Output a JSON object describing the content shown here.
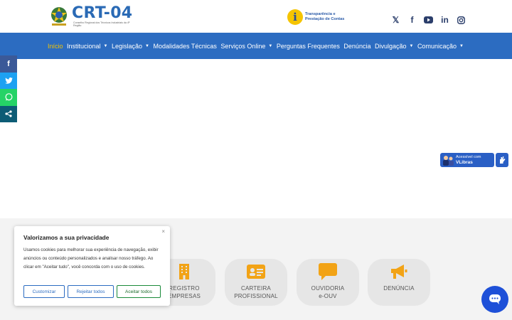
{
  "header": {
    "brand_name": "CRT-04",
    "brand_sub": "Conselho Regional dos Técnicos Industriais da 4ª Região",
    "transparency_label": "Transparência e Prestação de Contas",
    "social": [
      "𝕏",
      "f",
      "▶",
      "in",
      "◎"
    ]
  },
  "nav": {
    "items": [
      {
        "label": "Início",
        "dropdown": false,
        "active": true
      },
      {
        "label": "Institucional",
        "dropdown": true
      },
      {
        "label": "Legislação",
        "dropdown": true
      },
      {
        "label": "Modalidades Técnicas",
        "dropdown": false
      },
      {
        "label": "Serviços Online",
        "dropdown": true
      },
      {
        "label": "Perguntas Frequentes",
        "dropdown": false
      },
      {
        "label": "Denúncia",
        "dropdown": false
      },
      {
        "label": "Divulgação",
        "dropdown": true
      },
      {
        "label": "Comunicação",
        "dropdown": true
      }
    ],
    "chevron": "⌄"
  },
  "share": {
    "facebook": "f",
    "twitter": "t",
    "whatsapp": "w",
    "share": "<"
  },
  "vlibras": {
    "line1": "Acessível com",
    "line2": "VLibras"
  },
  "cards": [
    {
      "icon": "building-icon",
      "line1": "REGISTRO",
      "line2": "EMPRESAS"
    },
    {
      "icon": "id-card-icon",
      "line1": "CARTEIRA",
      "line2": "PROFISSIONAL"
    },
    {
      "icon": "speech-bubble-icon",
      "line1": "OUVIDORIA",
      "line2": "e-OUV"
    },
    {
      "icon": "megaphone-icon",
      "line1": "DENÚNCIA",
      "line2": ""
    }
  ],
  "cookie": {
    "title": "Valorizamos a sua privacidade",
    "body": "Usamos cookies para melhorar sua experiência de navegação, exibir anúncios ou conteúdo personalizados e analisar nosso tráfego. Ao clicar em \"Aceitar tudo\", você concorda com o uso de cookies.",
    "customize": "Customizar",
    "reject": "Rejeitar todos",
    "accept": "Aceitar todos",
    "close": "×"
  },
  "colors": {
    "nav_bg": "#2c6cc1",
    "accent": "#f5c400",
    "card_icon": "#f2a316",
    "chat": "#1e50d8"
  }
}
